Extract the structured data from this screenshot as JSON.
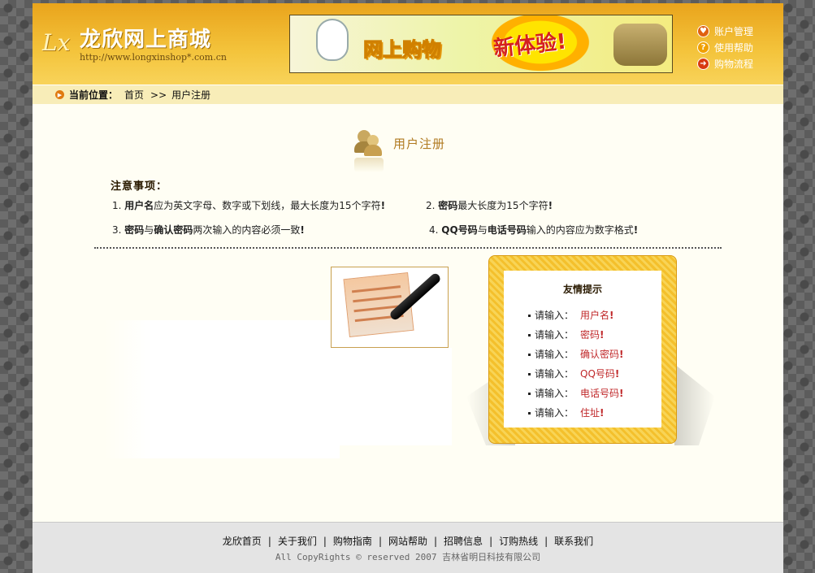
{
  "header": {
    "logo_mark": "Lx",
    "logo_title": "龙欣网上商城",
    "logo_url": "http://www.longxinshop*.com.cn",
    "banner_text": "网上购物",
    "banner_new": "新体验!",
    "links": [
      {
        "label": "账户管理",
        "icon": "account-icon"
      },
      {
        "label": "使用帮助",
        "icon": "help-icon"
      },
      {
        "label": "购物流程",
        "icon": "flow-icon"
      }
    ]
  },
  "breadcrumb": {
    "label": "当前位置：",
    "home": "首页",
    "separator": ">>",
    "current": "用户注册"
  },
  "register": {
    "title": "用户注册",
    "notice_title": "注意事项：",
    "rules": [
      {
        "num": "1.",
        "bold1": "用户名",
        "text1": "应为英文字母、数字或下划线，最大长度为15个字符",
        "bang": "!"
      },
      {
        "num": "2.",
        "bold1": "密码",
        "text1": "最大长度为15个字符",
        "bang": "!"
      },
      {
        "num": "3.",
        "bold1": "密码",
        "mid": "与",
        "bold2": "确认密码",
        "text1": "两次输入的内容必须一致",
        "bang": "!"
      },
      {
        "num": "4.",
        "bold1": "QQ号码",
        "mid": "与",
        "bold2": "电话号码",
        "text1": "输入的内容应为数字格式",
        "bang": "!"
      }
    ]
  },
  "tips": {
    "title": "友情提示",
    "items": [
      {
        "label": "请输入：",
        "value": "用户名",
        "bang": "!"
      },
      {
        "label": "请输入：",
        "value": "密码",
        "bang": "!"
      },
      {
        "label": "请输入：",
        "value": "确认密码",
        "bang": "!"
      },
      {
        "label": "请输入：",
        "value": "QQ号码",
        "bang": "!"
      },
      {
        "label": "请输入：",
        "value": "电话号码",
        "bang": "!"
      },
      {
        "label": "请输入：",
        "value": "住址",
        "bang": "!"
      }
    ]
  },
  "footer": {
    "links": [
      "龙欣首页",
      "关于我们",
      "购物指南",
      "网站帮助",
      "招聘信息",
      "订购热线",
      "联系我们"
    ],
    "separator": "|",
    "copyright": "All CopyRights © reserved 2007 吉林省明日科技有限公司"
  },
  "colors": {
    "header_gold": "#f4c43c",
    "breadcrumb_bg": "#f8edb8",
    "accent_red": "#c0282a",
    "title_brown": "#b07a20"
  }
}
